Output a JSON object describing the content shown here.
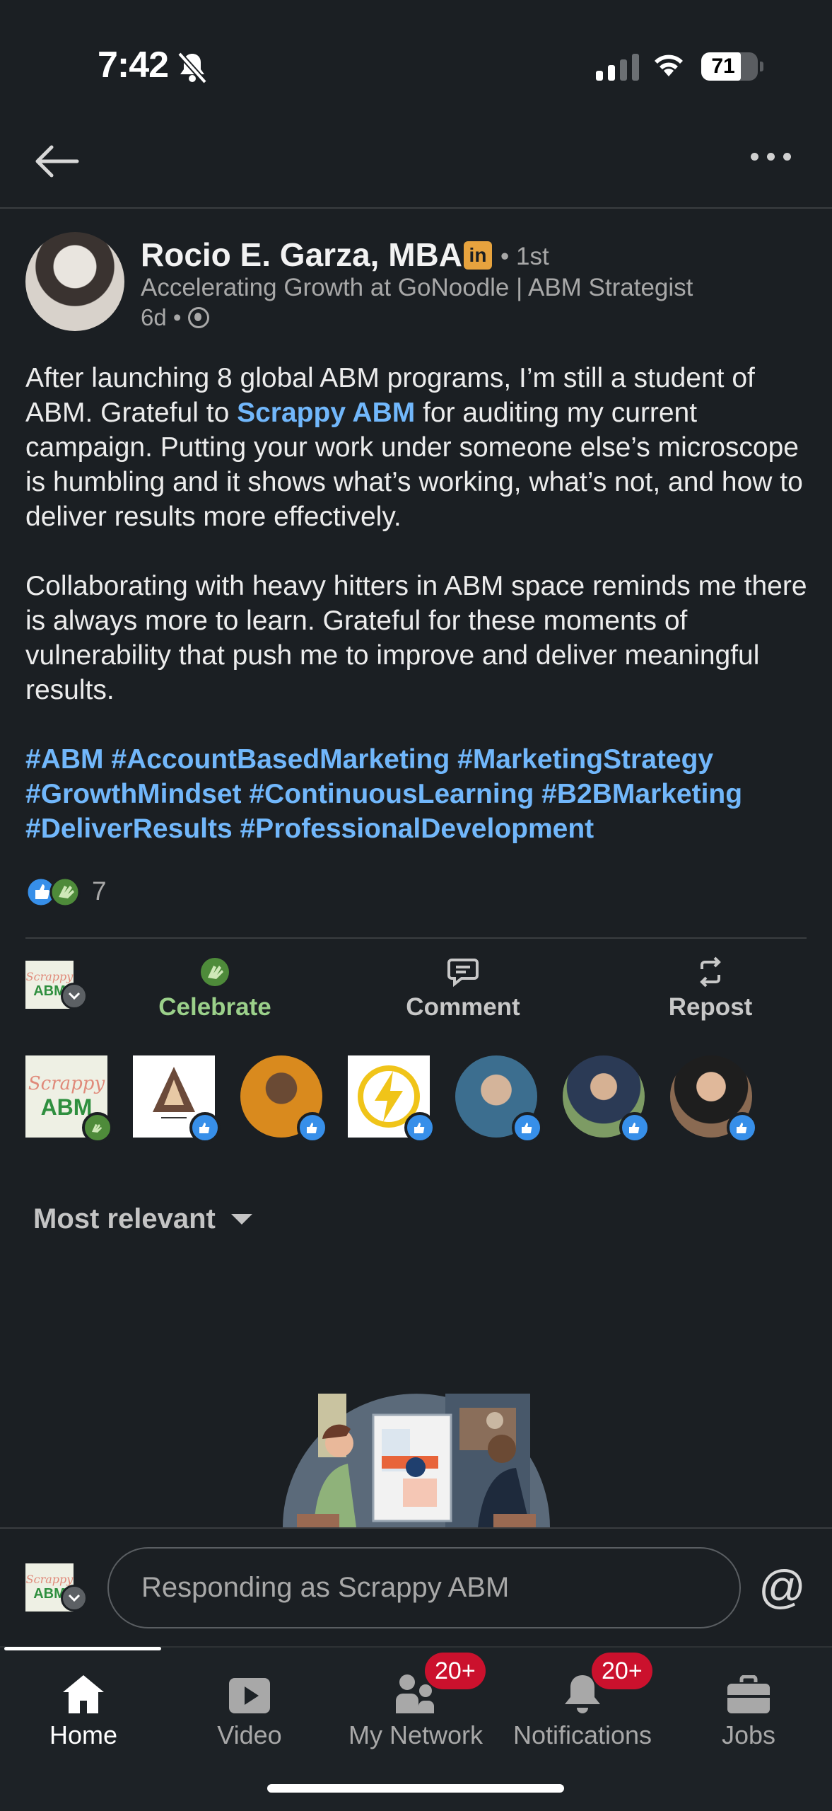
{
  "status_bar": {
    "time": "7:42",
    "battery": "71",
    "icons": [
      "bell-off-icon",
      "signal-icon",
      "wifi-icon",
      "battery-icon"
    ]
  },
  "nav": {
    "icons": [
      "back-arrow-icon",
      "more-icon"
    ]
  },
  "post": {
    "author": "Rocio E. Garza, MBA",
    "badge": "in",
    "degree": "• 1st",
    "headline": "Accelerating Growth at GoNoodle | ABM Strategist",
    "age": "6d •",
    "para1_a": "After launching 8 global ABM programs, I’m still a student of ABM. Grateful to ",
    "para1_link": "Scrappy ABM",
    "para1_b": " for auditing my current campaign. Putting your work under someone else’s microscope is humbling and it shows what’s working, what’s not, and how to deliver results more effectively.",
    "para2": "Collaborating with heavy hitters in ABM space reminds me there is always more to learn. Grateful for these moments of vulnerability that push me to improve and deliver meaningful results.",
    "hashtags": "#ABM #AccountBasedMarketing #MarketingStrategy #GrowthMindset #ContinuousLearning #B2BMarketing #DeliverResults #ProfessionalDevelopment",
    "reaction_count": "7"
  },
  "actions": {
    "logo_line1": "Scrappy",
    "logo_line2": "ABM",
    "celebrate": "Celebrate",
    "comment": "Comment",
    "repost": "Repost"
  },
  "sort": {
    "label": "Most relevant"
  },
  "composer": {
    "placeholder": "Responding as Scrappy ABM",
    "at": "@"
  },
  "tabs": {
    "home": "Home",
    "video": "Video",
    "network": "My Network",
    "network_badge": "20+",
    "notifications": "Notifications",
    "notifications_badge": "20+",
    "jobs": "Jobs"
  },
  "colors": {
    "background": "#1b1f23",
    "link": "#71b7fb",
    "celebrate": "#9bd08a",
    "badge": "#cb112d",
    "like": "#378fe9"
  }
}
